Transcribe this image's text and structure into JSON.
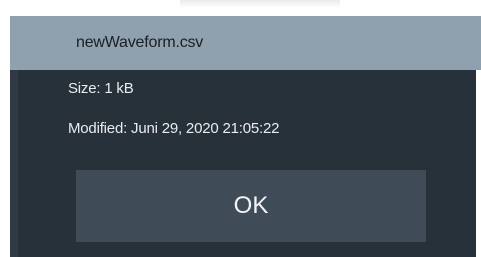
{
  "dialog": {
    "title": "newWaveform.csv",
    "size_text": "Size: 1 kB",
    "modified_text": "Modified: Juni 29, 2020 21:05:22",
    "ok_label": "OK"
  },
  "colors": {
    "title_bar": "#8fa0ae",
    "dialog_bg": "#2f3a44",
    "panel_bg": "#27313a",
    "button_bg": "#3f4c57",
    "text_light": "#e8ecef"
  }
}
